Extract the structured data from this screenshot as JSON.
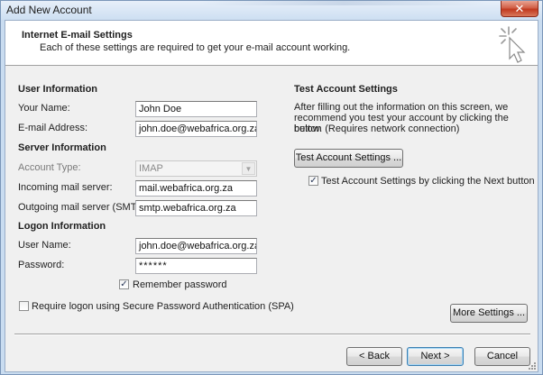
{
  "window": {
    "title": "Add New Account",
    "close_glyph": "✕"
  },
  "header": {
    "title": "Internet E-mail Settings",
    "subtitle": "Each of these settings are required to get your e-mail account working.",
    "icon": "cursor-sparkle-icon"
  },
  "user_info": {
    "heading": "User Information",
    "name_label": "Your Name:",
    "name_value": "John Doe",
    "email_label": "E-mail Address:",
    "email_value": "john.doe@webafrica.org.za"
  },
  "server_info": {
    "heading": "Server Information",
    "account_type_label": "Account Type:",
    "account_type_value": "IMAP",
    "incoming_label": "Incoming mail server:",
    "incoming_value": "mail.webafrica.org.za",
    "outgoing_label": "Outgoing mail server (SMTP):",
    "outgoing_value": "smtp.webafrica.org.za"
  },
  "logon_info": {
    "heading": "Logon Information",
    "username_label": "User Name:",
    "username_value": "john.doe@webafrica.org.za",
    "password_label": "Password:",
    "password_value": "******",
    "remember_label": "Remember password",
    "remember_checked": true,
    "spa_label": "Require logon using Secure Password Authentication (SPA)",
    "spa_checked": false
  },
  "test_settings": {
    "heading": "Test Account Settings",
    "description_1": "After filling out the information on this screen, we",
    "description_2": "recommend you test your account by clicking the button",
    "description_3": "below. (Requires network connection)",
    "test_button": "Test Account Settings ...",
    "next_check_label": "Test Account Settings by clicking the Next button",
    "next_check_checked": true
  },
  "buttons": {
    "more_settings": "More Settings ...",
    "back": "< Back",
    "next": "Next >",
    "cancel": "Cancel"
  },
  "check_glyph": "✓"
}
